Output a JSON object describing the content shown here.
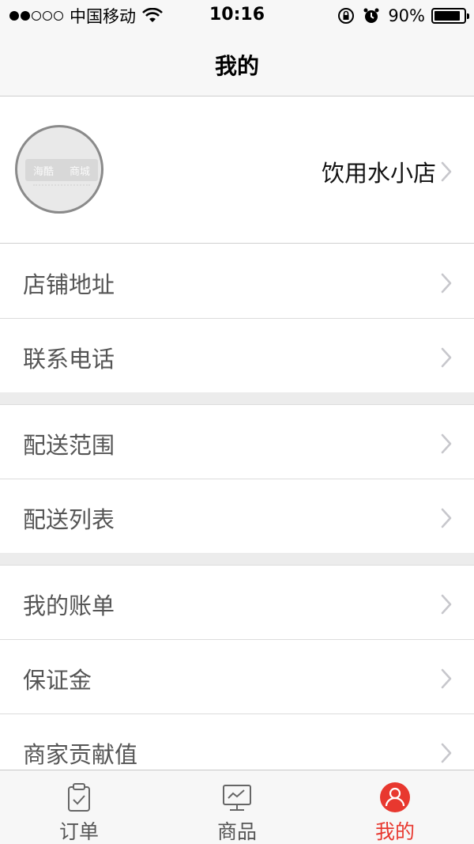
{
  "status_bar": {
    "carrier": "中国移动",
    "time": "10:16",
    "battery": "90%",
    "battery_level": 0.9,
    "signal_dots_filled": 2,
    "signal_dots_total": 5
  },
  "nav": {
    "title": "我的"
  },
  "profile": {
    "avatar_text_1": "海酷",
    "avatar_text_2": "商城",
    "store_name": "饮用水小店"
  },
  "menu": {
    "group1": [
      {
        "label": "店铺地址"
      },
      {
        "label": "联系电话"
      }
    ],
    "group2": [
      {
        "label": "配送范围"
      },
      {
        "label": "配送列表"
      }
    ],
    "group3": [
      {
        "label": "我的账单"
      },
      {
        "label": "保证金"
      },
      {
        "label": "商家贡献值"
      }
    ]
  },
  "tabs": [
    {
      "label": "订单",
      "icon": "clipboard-icon",
      "active": false
    },
    {
      "label": "商品",
      "icon": "monitor-icon",
      "active": false
    },
    {
      "label": "我的",
      "icon": "user-icon",
      "active": true
    }
  ],
  "colors": {
    "accent": "#e8382f",
    "chevron": "#c7c7cc",
    "label": "#555555"
  }
}
